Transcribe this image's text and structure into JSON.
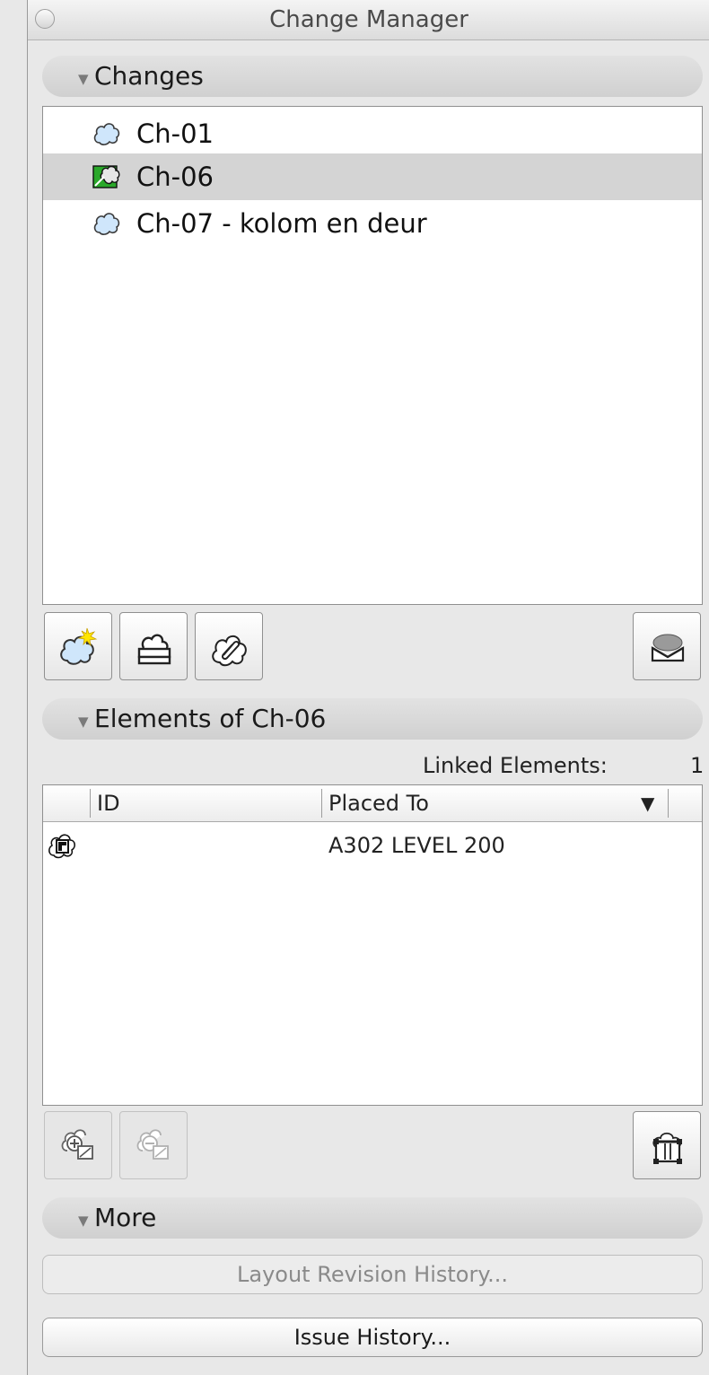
{
  "window": {
    "title": "Change Manager"
  },
  "changes_section": {
    "title": "Changes",
    "items": [
      {
        "label": "Ch-01",
        "icon": "cloud-icon",
        "selected": false
      },
      {
        "label": "Ch-06",
        "icon": "green-issue-cloud-icon",
        "selected": true
      },
      {
        "label": "Ch-07 - kolom en deur",
        "icon": "cloud-icon",
        "selected": false
      }
    ],
    "toolbar": {
      "new_change": "new-change-icon",
      "print_change": "print-change-icon",
      "link_change": "link-change-icon",
      "settings": "change-settings-icon"
    }
  },
  "elements_section": {
    "title": "Elements of Ch-06",
    "linked_label": "Linked Elements:",
    "linked_count": "1",
    "columns": {
      "id": "ID",
      "placed_to": "Placed To"
    },
    "rows": [
      {
        "id": "",
        "placed_to": "A302 LEVEL 200",
        "icon": "revision-cloud-marker-icon"
      }
    ]
  },
  "more_section": {
    "title": "More",
    "layout_revision_button": "Layout Revision History...",
    "issue_history_button": "Issue History..."
  }
}
